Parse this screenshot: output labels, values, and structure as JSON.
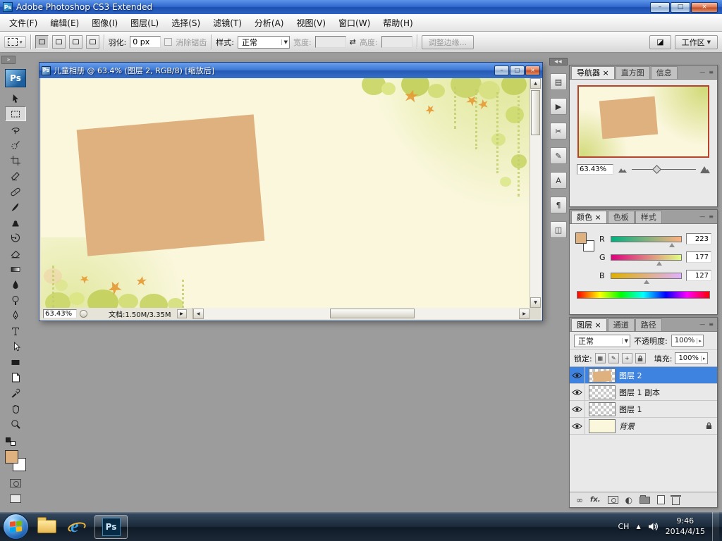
{
  "titlebar": {
    "title": "Adobe Photoshop CS3 Extended"
  },
  "menubar": {
    "items": [
      {
        "label": "文件(F)"
      },
      {
        "label": "编辑(E)"
      },
      {
        "label": "图像(I)"
      },
      {
        "label": "图层(L)"
      },
      {
        "label": "选择(S)"
      },
      {
        "label": "滤镜(T)"
      },
      {
        "label": "分析(A)"
      },
      {
        "label": "视图(V)"
      },
      {
        "label": "窗口(W)"
      },
      {
        "label": "帮助(H)"
      }
    ]
  },
  "optionsbar": {
    "feather_label": "羽化:",
    "feather_value": "0 px",
    "antialias_label": "消除锯齿",
    "style_label": "样式:",
    "style_value": "正常",
    "width_label": "宽度:",
    "width_value": "",
    "height_label": "高度:",
    "height_value": "",
    "refine_edge_label": "调整边缘...",
    "workspace_label": "工作区"
  },
  "document": {
    "title": "儿童相册 @ 63.4% (图层 2, RGB/8) [缩放后]",
    "status_zoom": "63.43%",
    "status_doc": "文档:1.50M/3.35M"
  },
  "navigator_panel": {
    "tabs": [
      {
        "label": "导航器 ×"
      },
      {
        "label": "直方图"
      },
      {
        "label": "信息"
      }
    ],
    "zoom_value": "63.43%"
  },
  "color_panel": {
    "tabs": [
      {
        "label": "颜色 ×"
      },
      {
        "label": "色板"
      },
      {
        "label": "样式"
      }
    ],
    "channels": [
      {
        "label": "R",
        "value": "223"
      },
      {
        "label": "G",
        "value": "177"
      },
      {
        "label": "B",
        "value": "127"
      }
    ]
  },
  "layers_panel": {
    "tabs": [
      {
        "label": "图层 ×"
      },
      {
        "label": "通道"
      },
      {
        "label": "路径"
      }
    ],
    "blend_mode": "正常",
    "opacity_label": "不透明度:",
    "opacity_value": "100%",
    "lock_label": "锁定:",
    "fill_label": "填充:",
    "fill_value": "100%",
    "layers": [
      {
        "name": "图层 2"
      },
      {
        "name": "图层 1 副本"
      },
      {
        "name": "图层 1"
      },
      {
        "name": "背景"
      }
    ]
  },
  "taskbar": {
    "ps_button": "Ps",
    "tray_language": "CH",
    "tray_time": "9:46",
    "tray_date": "2014/4/15"
  },
  "colors": {
    "foreground_tan": "#dfb17f",
    "canvas_cream": "#faf7dd",
    "selection_blue": "#3f83e0",
    "titlebar_blue": "#2f68cc"
  },
  "icons": {
    "minimize": "–",
    "maximize": "□",
    "restore": "□",
    "close": "×",
    "dropdown_arrow": "▼",
    "small_down": "▾",
    "spin_arrow": "▸",
    "scroll_up": "▲",
    "scroll_down": "▼",
    "scroll_left": "◀",
    "scroll_right": "▶",
    "dock_collapse": "◀◀",
    "toolbox_collapse": "»",
    "panel_menu": "≡",
    "panel_min": "—",
    "swap": "⇄",
    "dock_brushes": "▤",
    "dock_animation": "▶",
    "dock_clone": "✂",
    "dock_presets": "✎",
    "dock_character": "A",
    "dock_paragraph": "¶",
    "dock_comps": "◫",
    "bridge": "◪",
    "tray_caret": "▲",
    "link": "∞",
    "adjust": "◐",
    "fx": "fx.",
    "lock_transparent": "▦",
    "lock_paint": "✎",
    "lock_move": "+",
    "ie": "e"
  }
}
